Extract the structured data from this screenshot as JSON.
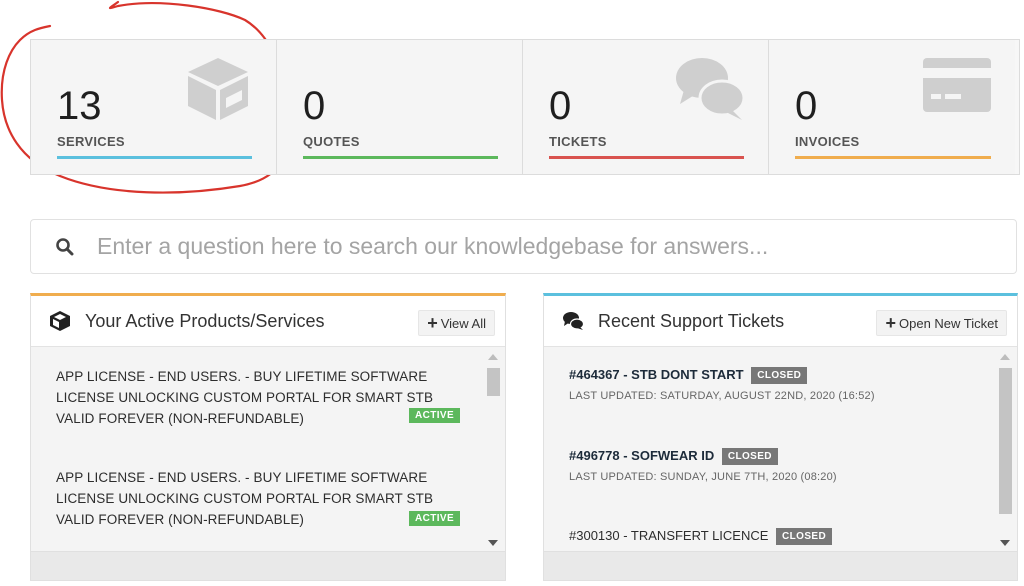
{
  "stats": [
    {
      "value": "13",
      "label": "SERVICES",
      "color": "#5bc0de",
      "icon": "box-icon"
    },
    {
      "value": "0",
      "label": "QUOTES",
      "color": "#5cb85c",
      "icon": ""
    },
    {
      "value": "0",
      "label": "TICKETS",
      "color": "#d9534f",
      "icon": "comments-icon"
    },
    {
      "value": "0",
      "label": "INVOICES",
      "color": "#f0ad4e",
      "icon": "credit-card-icon"
    }
  ],
  "search": {
    "placeholder": "Enter a question here to search our knowledgebase for answers..."
  },
  "products_panel": {
    "title": "Your Active Products/Services",
    "accent": "#f0ad4e",
    "view_all": "View All",
    "items": [
      {
        "name": "APP LICENSE - END USERS. - BUY LIFETIME SOFTWARE LICENSE UNLOCKING CUSTOM PORTAL FOR SMART STB VALID FOREVER (NON-REFUNDABLE)",
        "status": "ACTIVE"
      },
      {
        "name": "APP LICENSE - END USERS. - BUY LIFETIME SOFTWARE LICENSE UNLOCKING CUSTOM PORTAL FOR SMART STB VALID FOREVER (NON-REFUNDABLE)",
        "status": "ACTIVE"
      }
    ]
  },
  "tickets_panel": {
    "title": "Recent Support Tickets",
    "accent": "#5bc0de",
    "open_new": "Open New Ticket",
    "items": [
      {
        "title": "#464367 - STB DONT START",
        "status": "CLOSED",
        "updated": "LAST UPDATED: SATURDAY, AUGUST 22ND, 2020 (16:52)"
      },
      {
        "title": "#496778 - SOFWEAR ID",
        "status": "CLOSED",
        "updated": "LAST UPDATED: SUNDAY, JUNE 7TH, 2020 (08:20)"
      },
      {
        "title": "#300130 - TRANSFERT LICENCE",
        "status": "CLOSED",
        "updated": ""
      }
    ]
  }
}
